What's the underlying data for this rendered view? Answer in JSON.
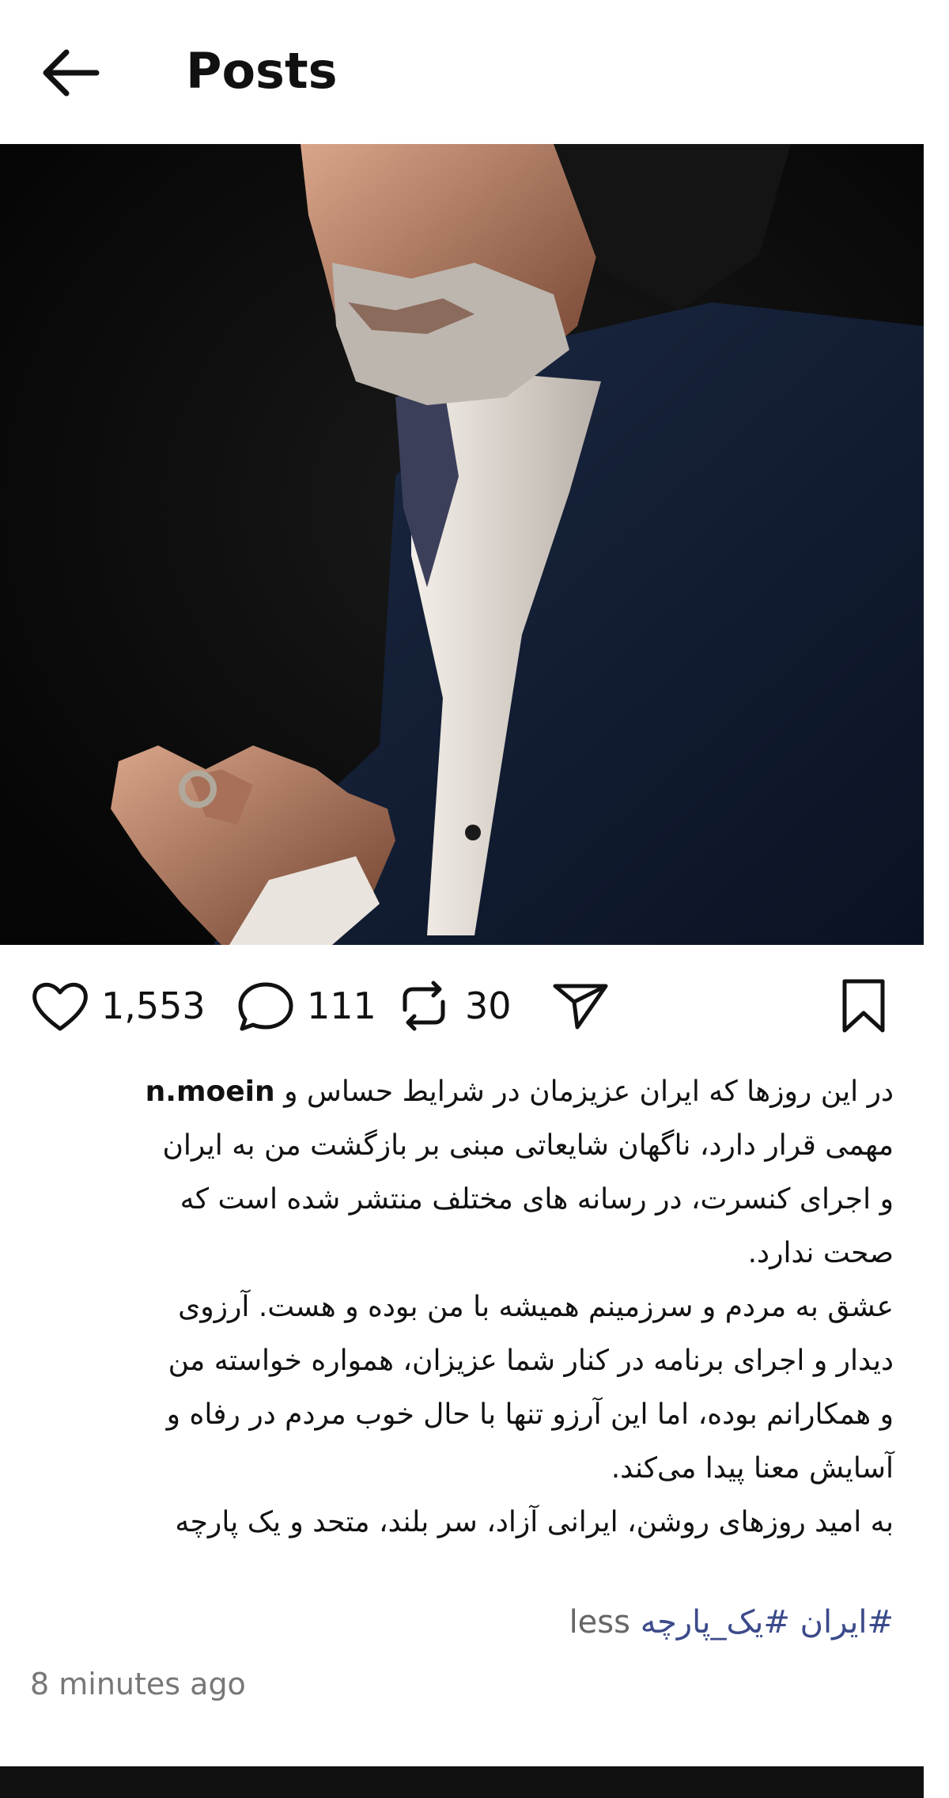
{
  "header": {
    "title": "Posts",
    "back_icon": "arrow-left-icon"
  },
  "post": {
    "image_icons": {
      "mute": "speaker-muted-icon"
    },
    "actions": {
      "likes": "1,553",
      "comments": "111",
      "reposts": "30",
      "like_icon": "heart-icon",
      "comment_icon": "speech-bubble-icon",
      "repost_icon": "repost-icon",
      "share_icon": "send-icon",
      "bookmark_icon": "bookmark-icon"
    },
    "caption": {
      "username": "n.moein",
      "line1_rest": "در این روزها که ایران عزیزمان در شرایط حساس و",
      "line2": "مهمی قرار دارد، ناگهان شایعاتی مبنی بر بازگشت من به ایران",
      "line3": "و اجرای کنسرت، در رسانه های مختلف منتشر شده است که",
      "line4": "صحت ندارد.",
      "line5": "عشق به مردم و سرزمینم همیشه با من بوده و هست. آرزوی",
      "line6": "دیدار و اجرای برنامه در کنار شما عزیزان، همواره خواسته من",
      "line7": "و همکارانم بوده، اما این آرزو تنها با حال خوب مردم در رفاه و",
      "line8": "آسایش معنا پیدا می‌کند.",
      "line9": "به امید روزهای روشن، ایرانی آزاد، سر بلند، متحد و یک پارچه"
    },
    "hashtags": [
      "#ایران",
      "#یک_پارچه"
    ],
    "less_label": "less",
    "timestamp": "8 minutes ago"
  }
}
